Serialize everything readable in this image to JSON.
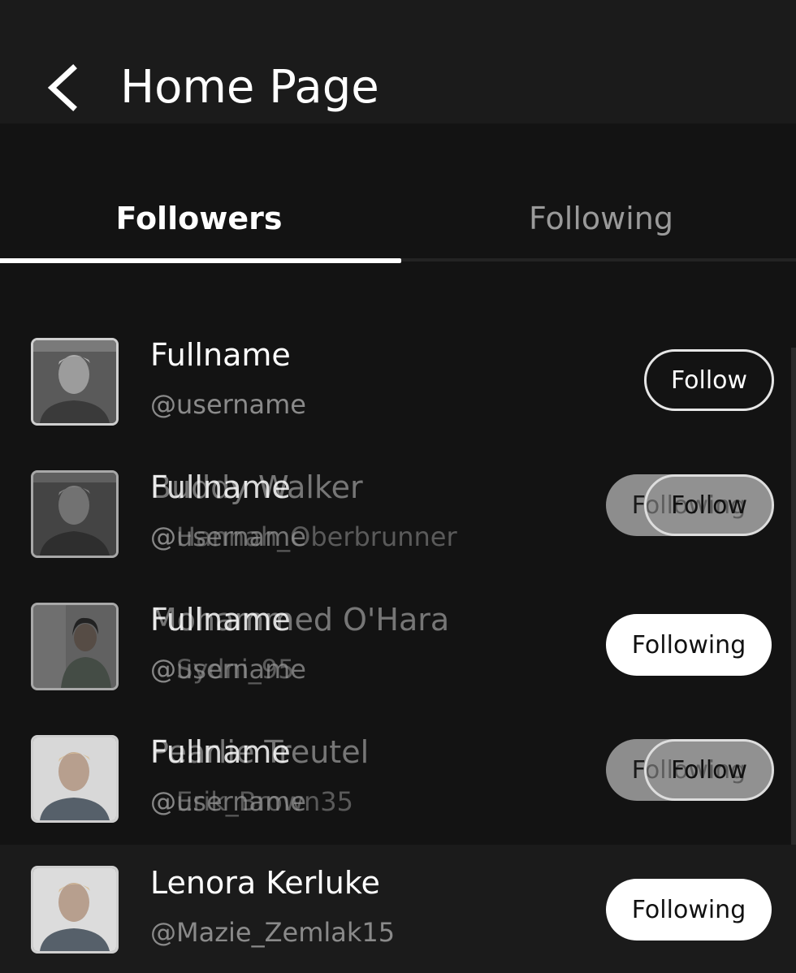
{
  "header": {
    "title": "Home Page"
  },
  "tabs": [
    {
      "label": "Followers",
      "active": true
    },
    {
      "label": "Following",
      "active": false
    }
  ],
  "list": {
    "rows": [
      {
        "fullname": "Fullname",
        "username": "@username",
        "button": "Follow"
      },
      {
        "ghost": {
          "fullname": "Buddy Walker",
          "username": "@Hannah_Oberbrunner",
          "button": "Following"
        },
        "front": {
          "fullname": "Fullname",
          "username": "@username",
          "button": "Follow"
        }
      },
      {
        "ghost": {
          "fullname": "Mohammed O'Hara",
          "username": "@Sydni_95"
        },
        "front": {
          "fullname": "Fullname",
          "username": "@username"
        },
        "button": "Following"
      },
      {
        "ghost": {
          "fullname": "Pearlie Treutel",
          "username": "@Erik_Brown35",
          "button": "Following"
        },
        "front": {
          "fullname": "Fullname",
          "username": "@username",
          "button": "Follow"
        }
      },
      {
        "fullname": "Lenora Kerluke",
        "username": "@Mazie_Zemlak15",
        "button": "Following"
      }
    ]
  },
  "colors": {
    "background": "#131313",
    "header": "#1b1b1b",
    "accent": "#ffffff",
    "muted_text": "#8a8a8a"
  },
  "icons": {
    "back": "chevron-left-icon"
  }
}
